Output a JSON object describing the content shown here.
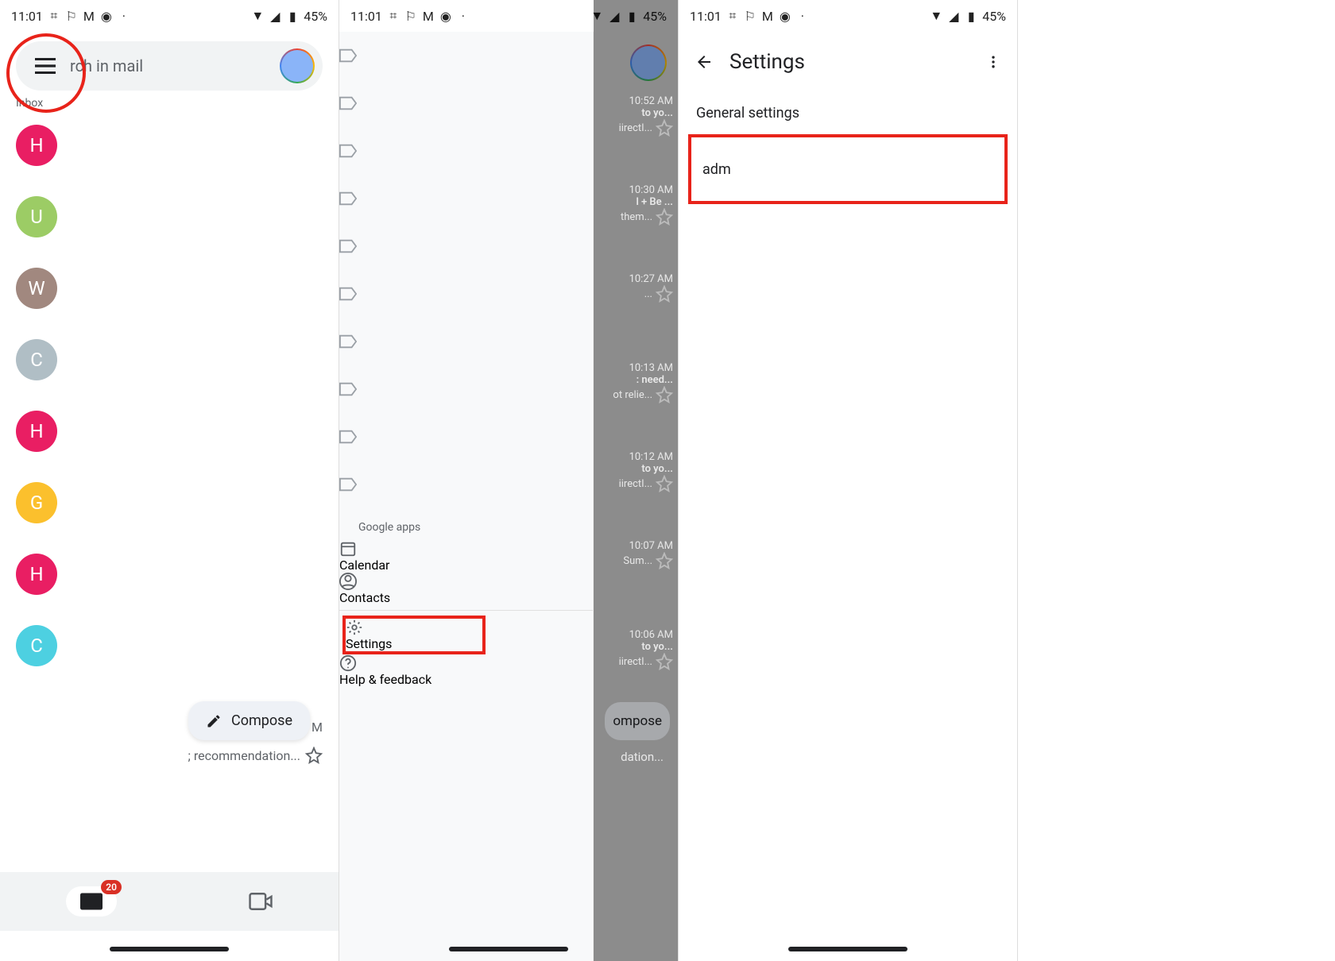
{
  "statusbar": {
    "time": "11:01",
    "battery": "45%"
  },
  "panel1": {
    "search_placeholder": "rch in mail",
    "inbox_label": "Inbox",
    "avatars": [
      {
        "letter": "H",
        "color": "#e91e63"
      },
      {
        "letter": "U",
        "color": "#9ccc65"
      },
      {
        "letter": "W",
        "color": "#a1887f"
      },
      {
        "letter": "C",
        "color": "#b0bec5"
      },
      {
        "letter": "H",
        "color": "#e91e63"
      },
      {
        "letter": "G",
        "color": "#fbc02d"
      },
      {
        "letter": "H",
        "color": "#e91e63"
      },
      {
        "letter": "C",
        "color": "#4dd0e1"
      }
    ],
    "compose_label": "Compose",
    "snippet_tail_time": "M",
    "snippet_tail_text": "; recommendation...",
    "badge_count": "20"
  },
  "panel2": {
    "section_apps": "Google apps",
    "apps": [
      {
        "name": "Calendar",
        "icon": "calendar"
      },
      {
        "name": "Contacts",
        "icon": "contacts"
      }
    ],
    "footer": [
      {
        "name": "Settings",
        "icon": "settings"
      },
      {
        "name": "Help & feedback",
        "icon": "help"
      }
    ],
    "peek": [
      {
        "time": "10:52 AM",
        "l1": "to yo...",
        "l2": "iirectI..."
      },
      {
        "time": "10:30 AM",
        "l1": "l + Be ...",
        "l2": "them..."
      },
      {
        "time": "10:27 AM",
        "l1": "",
        "l2": "..."
      },
      {
        "time": "10:13 AM",
        "l1": ": need...",
        "l2": "ot relie..."
      },
      {
        "time": "10:12 AM",
        "l1": "to yo...",
        "l2": "iirectI..."
      },
      {
        "time": "10:07 AM",
        "l1": "",
        "l2": "Sum..."
      },
      {
        "time": "10:06 AM",
        "l1": "to yo...",
        "l2": "iirectI..."
      }
    ],
    "compose_peek": "ompose",
    "dation": "dation..."
  },
  "panel3": {
    "title": "Settings",
    "general": "General settings",
    "account": "adm"
  }
}
